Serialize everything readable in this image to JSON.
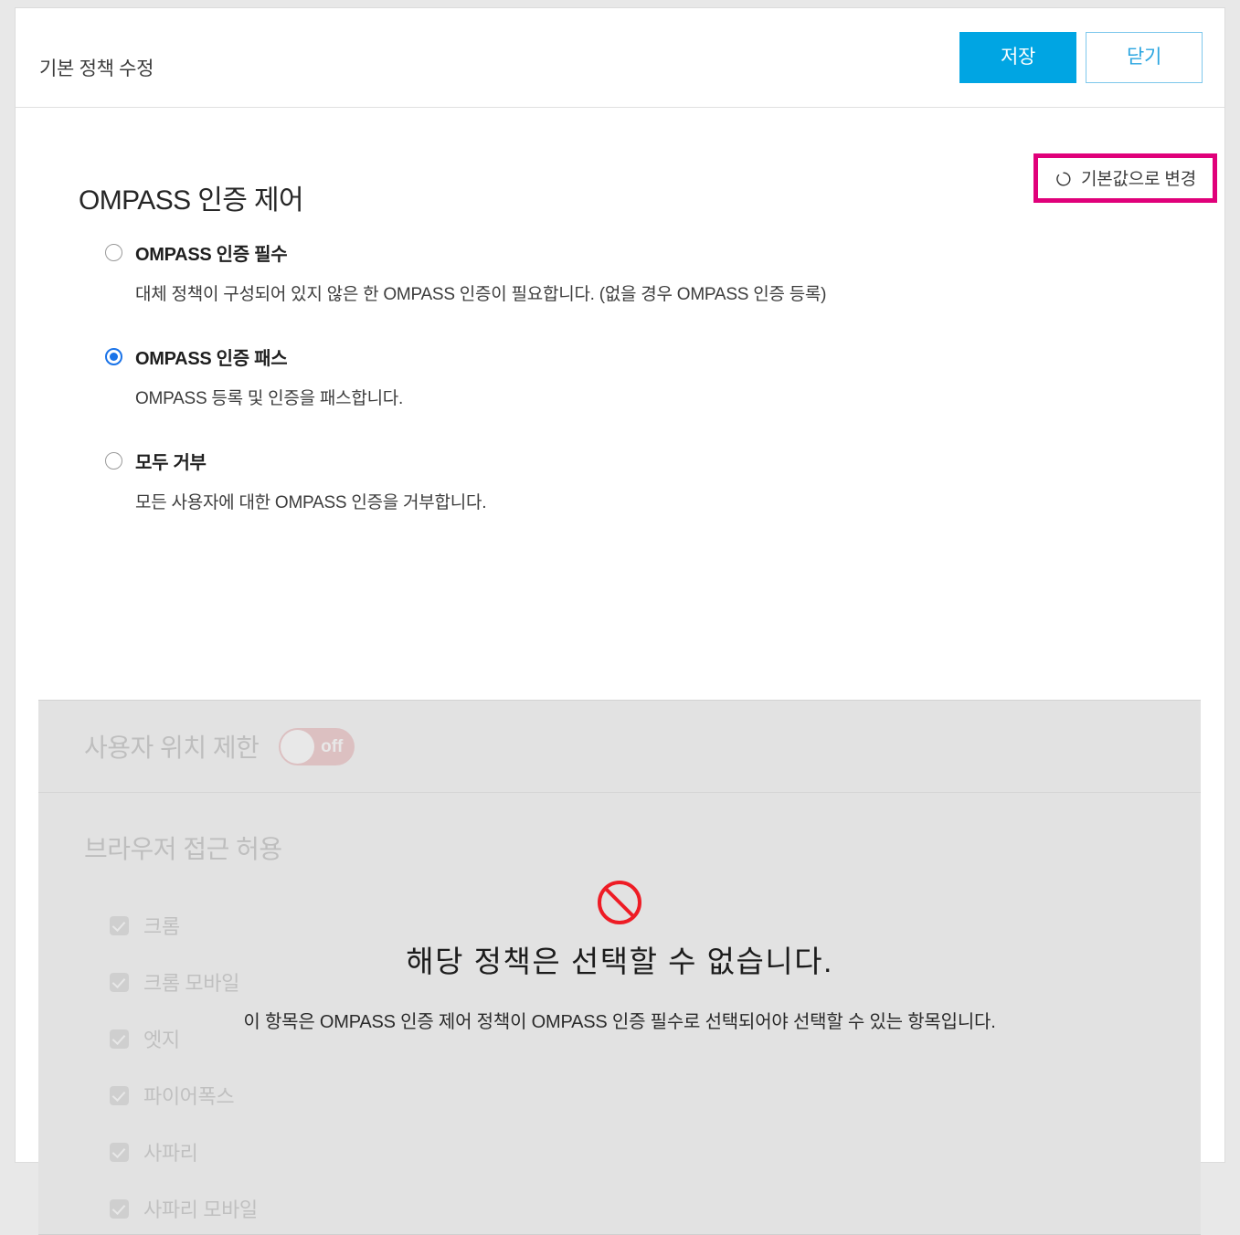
{
  "header": {
    "title": "기본 정책 수정",
    "save_label": "저장",
    "close_label": "닫기",
    "accent_color": "#00a5e3"
  },
  "reset": {
    "label": "기본값으로 변경",
    "icon": "restore-icon",
    "highlight_color": "#e0007a"
  },
  "section": {
    "title": "OMPASS 인증 제어",
    "options": [
      {
        "label": "OMPASS 인증 필수",
        "desc": "대체 정책이 구성되어 있지 않은 한 OMPASS 인증이 필요합니다. (없을 경우 OMPASS 인증 등록)",
        "selected": false
      },
      {
        "label": "OMPASS 인증 패스",
        "desc": "OMPASS 등록 및 인증을 패스합니다.",
        "selected": true
      },
      {
        "label": "모두 거부",
        "desc": "모든 사용자에 대한 OMPASS 인증을 거부합니다.",
        "selected": false
      }
    ]
  },
  "disabled_panel": {
    "location": {
      "title": "사용자 위치 제한",
      "toggle_state": "off",
      "toggle_color": "#c94a52"
    },
    "browsers": {
      "title": "브라우저 접근 허용",
      "items": [
        {
          "label": "크롬",
          "checked": true
        },
        {
          "label": "크롬 모바일",
          "checked": true
        },
        {
          "label": "엣지",
          "checked": true
        },
        {
          "label": "파이어폭스",
          "checked": true
        },
        {
          "label": "사파리",
          "checked": true
        },
        {
          "label": "사파리 모바일",
          "checked": true
        }
      ]
    },
    "overlay": {
      "icon": "prohibition-icon",
      "icon_color": "#ee1c25",
      "title": "해당 정책은 선택할 수 없습니다.",
      "subtitle": "이 항목은 OMPASS 인증 제어 정책이 OMPASS 인증 필수로 선택되어야 선택할 수 있는 항목입니다."
    }
  }
}
